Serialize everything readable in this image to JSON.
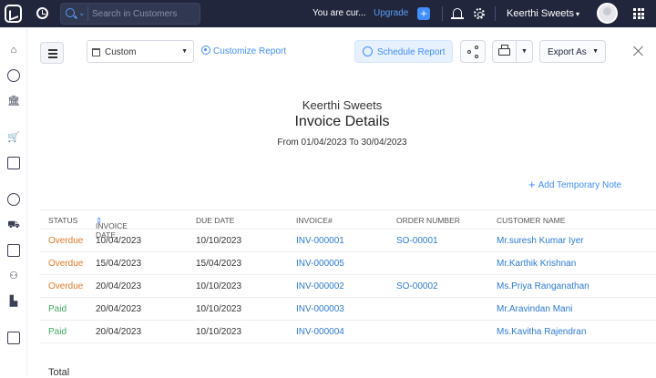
{
  "topbar": {
    "search_placeholder": "Search in Customers",
    "trial_text": "You are cur...",
    "upgrade_label": "Upgrade",
    "org_name": "Keerthi Sweets"
  },
  "toolbar": {
    "period_select": "Custom",
    "customize_label": "Customize Report",
    "schedule_label": "Schedule Report",
    "export_label": "Export As"
  },
  "report": {
    "org": "Keerthi Sweets",
    "title": "Invoice Details",
    "range": "From 01/04/2023 To 30/04/2023",
    "add_note": "Add Temporary Note",
    "columns": [
      "STATUS",
      "INVOICE DATE",
      "DUE DATE",
      "INVOICE#",
      "ORDER NUMBER",
      "CUSTOMER NAME"
    ],
    "sort_indicator": "⇕",
    "rows": [
      {
        "status": "Overdue",
        "invoice_date": "10/04/2023",
        "due_date": "10/10/2023",
        "invoice": "INV-000001",
        "order": "SO-00001",
        "customer": "Mr.suresh Kumar Iyer"
      },
      {
        "status": "Overdue",
        "invoice_date": "15/04/2023",
        "due_date": "15/04/2023",
        "invoice": "INV-000005",
        "order": "",
        "customer": "Mr.Karthik Krishnan"
      },
      {
        "status": "Overdue",
        "invoice_date": "20/04/2023",
        "due_date": "10/10/2023",
        "invoice": "INV-000002",
        "order": "SO-00002",
        "customer": "Ms.Priya Ranganathan"
      },
      {
        "status": "Paid",
        "invoice_date": "20/04/2023",
        "due_date": "10/10/2023",
        "invoice": "INV-000003",
        "order": "",
        "customer": "Mr.Aravindan Mani"
      },
      {
        "status": "Paid",
        "invoice_date": "20/04/2023",
        "due_date": "10/10/2023",
        "invoice": "INV-000004",
        "order": "",
        "customer": "Ms.Kavitha Rajendran"
      }
    ],
    "total_label": "Total"
  },
  "colors": {
    "topbar": "#21263c",
    "accent": "#408dfb",
    "overdue": "#e07a2c",
    "paid": "#3cab5c"
  },
  "icons": {
    "sidebar": [
      "home-icon",
      "items-icon",
      "banking-icon",
      "sales-icon",
      "purchases-icon",
      "time-icon",
      "ewaybill-icon",
      "accountant-icon",
      "contacts-icon",
      "reports-icon",
      "documents-icon"
    ]
  }
}
